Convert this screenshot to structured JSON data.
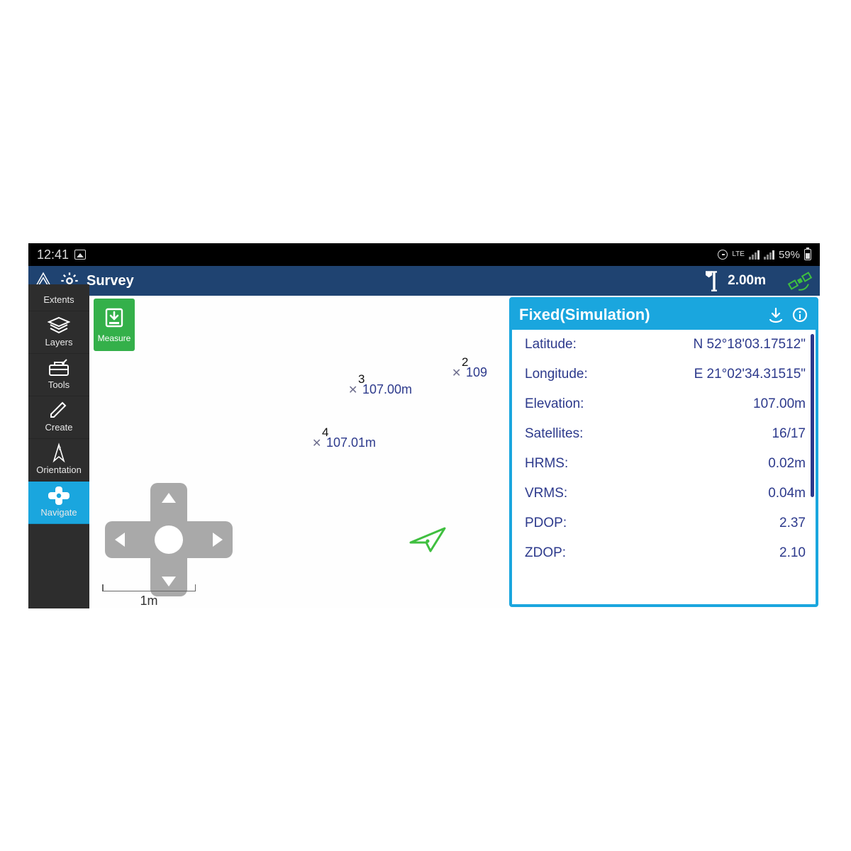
{
  "statusbar": {
    "time": "12:41",
    "network": "LTE",
    "battery_text": "59%"
  },
  "titlebar": {
    "title": "Survey",
    "pole_height": "2.00m"
  },
  "sidebar": {
    "extents": "Extents",
    "layers": "Layers",
    "tools": "Tools",
    "create": "Create",
    "orientation": "Orientation",
    "navigate": "Navigate"
  },
  "measure": {
    "label": "Measure"
  },
  "scale": {
    "label": "1m"
  },
  "points": {
    "p2": {
      "id": "2",
      "elev": "109"
    },
    "p3": {
      "id": "3",
      "elev": "107.00m"
    },
    "p4": {
      "id": "4",
      "elev": "107.01m"
    }
  },
  "info": {
    "header": "Fixed(Simulation)",
    "rows": {
      "latitude": {
        "k": "Latitude:",
        "v": "N  52°18'03.17512\""
      },
      "longitude": {
        "k": "Longitude:",
        "v": "E  21°02'34.31515\""
      },
      "elevation": {
        "k": "Elevation:",
        "v": "107.00m"
      },
      "satellites": {
        "k": "Satellites:",
        "v": "16/17"
      },
      "hrms": {
        "k": "HRMS:",
        "v": "0.02m"
      },
      "vrms": {
        "k": "VRMS:",
        "v": "0.04m"
      },
      "pdop": {
        "k": "PDOP:",
        "v": "2.37"
      },
      "zdop": {
        "k": "ZDOP:",
        "v": "2.10"
      }
    }
  }
}
